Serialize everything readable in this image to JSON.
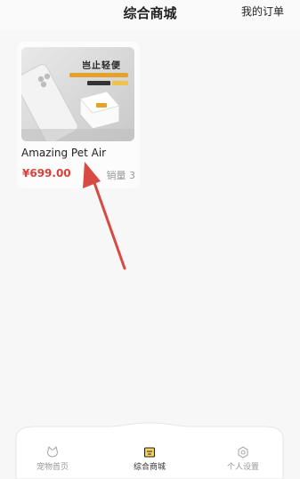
{
  "header": {
    "title": "综合商城",
    "orders_link": "我的订单"
  },
  "products": [
    {
      "name": "Amazing Pet Air",
      "price": "¥699.00",
      "sales": "销量 3",
      "image_banner": "岂止轻便"
    }
  ],
  "tabbar": {
    "tabs": [
      {
        "label": "宠物首页",
        "icon": "cat-face-icon",
        "active": false
      },
      {
        "label": "综合商城",
        "icon": "shop-icon",
        "active": true
      },
      {
        "label": "个人设置",
        "icon": "settings-icon",
        "active": false
      }
    ]
  },
  "colors": {
    "accent": "#d9403a",
    "active_icon": "#e8b100",
    "annotation_arrow": "#d94a44"
  }
}
